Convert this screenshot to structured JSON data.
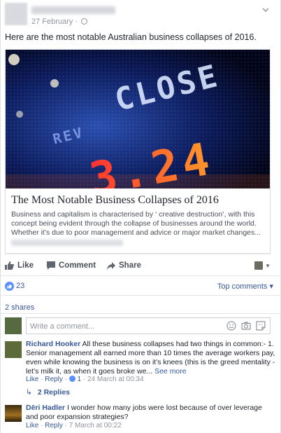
{
  "post": {
    "timestamp": "27 February ·",
    "text": "Here are the most notable Australian business collapses of 2016."
  },
  "link": {
    "image_text": "CLOSE",
    "image_number": "3.24",
    "title": "The Most Notable Business Collapses of 2016",
    "description": "Business and capitalism is characterised by ‘ creative destruction’, with this concept being evident through the collapse of businesses around the world. Whether it’s due to poor management and advice or major market changes..."
  },
  "actions": {
    "like": "Like",
    "comment": "Comment",
    "share": "Share"
  },
  "stats": {
    "likes": "23",
    "top_comments": "Top comments ▾",
    "shares": "2 shares"
  },
  "composer": {
    "placeholder": "Write a comment..."
  },
  "comments": [
    {
      "name": "Richard Hooker",
      "text": " All these business collapses had two things in common:- 1. Senior management all earned more than 10 times the average workers pay, even while knowing the business is on it's knees (this is the greed mentality - let's milk it, as when it goes broke we...",
      "see_more": " See more",
      "like": "Like",
      "reply": "Reply",
      "like_count": "1",
      "time": "24 March at 00:34",
      "replies": "2 Replies"
    },
    {
      "name": "Dēri Hadler",
      "text": " I wonder how many jobs were lost because of over leverage and poor expansion strategies?",
      "like": "Like",
      "reply": "Reply",
      "time": "7 March at 00:22"
    }
  ],
  "colors": {
    "link_blue": "#365899",
    "like_blue": "#5890ff",
    "meta_grey": "#90949c"
  }
}
